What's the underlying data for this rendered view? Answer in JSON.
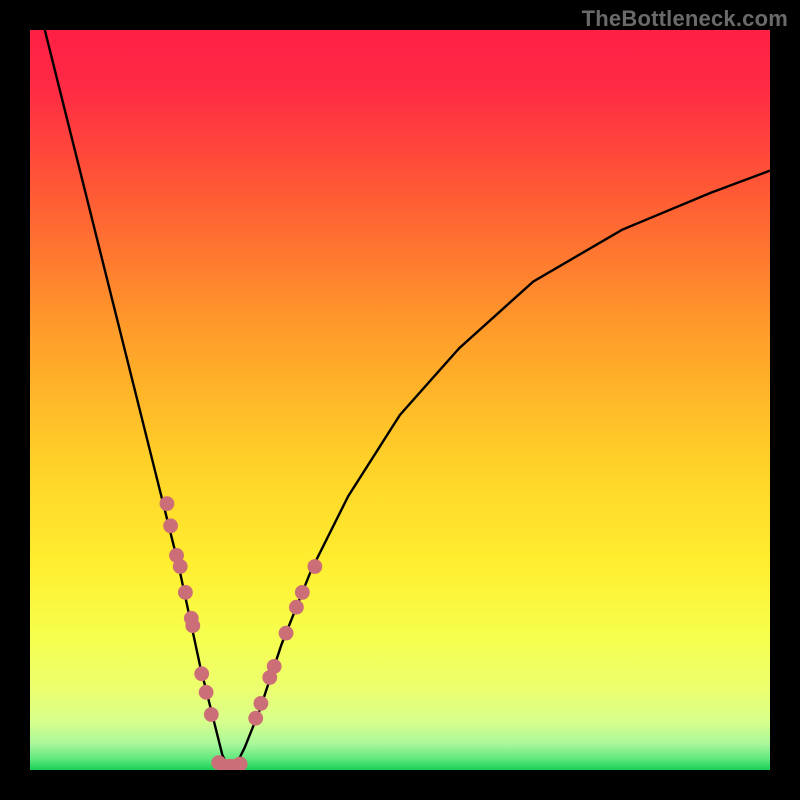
{
  "watermark": "TheBottleneck.com",
  "colors": {
    "bg_top": "#ff2541",
    "bg_mid1": "#ff8a2a",
    "bg_mid2": "#ffe531",
    "bg_low1": "#f7ff5a",
    "bg_low2": "#e6ff7a",
    "bg_bottom": "#1dd65a",
    "curve": "#000000",
    "dot": "#cc6e77",
    "canvas_border": "#000000"
  },
  "chart_data": {
    "type": "line",
    "title": "",
    "xlabel": "",
    "ylabel": "",
    "xlim": [
      0,
      100
    ],
    "ylim": [
      0,
      100
    ],
    "grid": false,
    "legend": false,
    "series": [
      {
        "name": "bottleneck-curve",
        "note": "V-shaped curve; minimum near x≈27. Values are estimated percentage bottleneck (y high = red = bad match, y low = green = good match).",
        "x": [
          2,
          5,
          8,
          11,
          14,
          17,
          20,
          23,
          25,
          26,
          27,
          28,
          29,
          31,
          34,
          38,
          43,
          50,
          58,
          68,
          80,
          92,
          100
        ],
        "y": [
          100,
          88,
          76,
          64,
          52,
          40,
          28,
          14,
          6,
          2,
          0,
          1,
          3,
          8,
          17,
          27,
          37,
          48,
          57,
          66,
          73,
          78,
          81
        ]
      }
    ],
    "dots": {
      "note": "Highlighted data markers clustered near the minimum on both flanks of the V. y ≈ estimated bottleneck %.",
      "left_branch": [
        {
          "x": 18.5,
          "y": 36
        },
        {
          "x": 19.0,
          "y": 33
        },
        {
          "x": 19.8,
          "y": 29
        },
        {
          "x": 20.3,
          "y": 27.5
        },
        {
          "x": 21.0,
          "y": 24
        },
        {
          "x": 21.8,
          "y": 20.5
        },
        {
          "x": 22.0,
          "y": 19.5
        },
        {
          "x": 23.2,
          "y": 13
        },
        {
          "x": 23.8,
          "y": 10.5
        },
        {
          "x": 24.5,
          "y": 7.5
        }
      ],
      "right_branch": [
        {
          "x": 30.5,
          "y": 7
        },
        {
          "x": 31.2,
          "y": 9
        },
        {
          "x": 32.4,
          "y": 12.5
        },
        {
          "x": 33.0,
          "y": 14
        },
        {
          "x": 34.6,
          "y": 18.5
        },
        {
          "x": 36.0,
          "y": 22
        },
        {
          "x": 36.8,
          "y": 24
        },
        {
          "x": 38.5,
          "y": 27.5
        }
      ],
      "bottom_cluster": [
        {
          "x": 25.5,
          "y": 1.0
        },
        {
          "x": 26.3,
          "y": 0.5
        },
        {
          "x": 27.0,
          "y": 0.5
        },
        {
          "x": 27.7,
          "y": 0.5
        },
        {
          "x": 28.4,
          "y": 0.8
        }
      ]
    }
  }
}
